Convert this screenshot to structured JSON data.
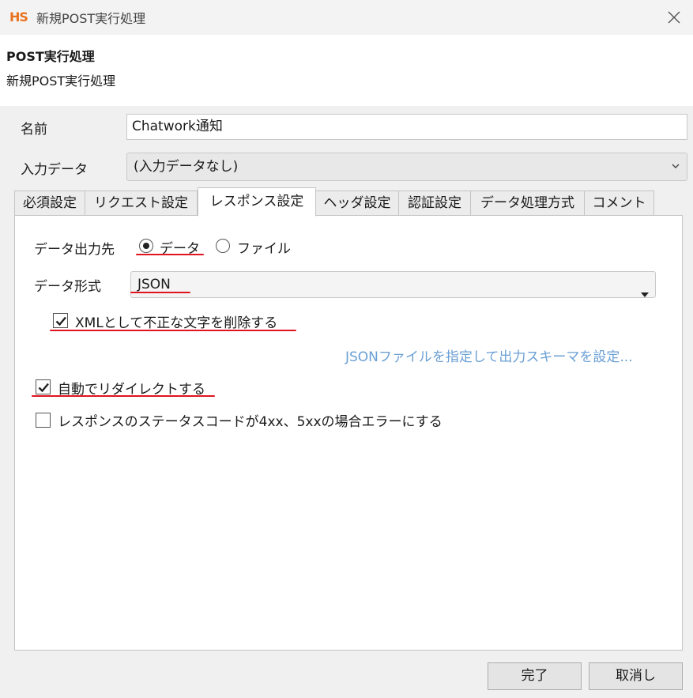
{
  "window": {
    "logo": "HS",
    "title": "新規POST実行処理"
  },
  "header": {
    "title": "POST実行処理",
    "subtitle": "新規POST実行処理"
  },
  "form": {
    "name_label": "名前",
    "name_value": "Chatwork通知",
    "input_data_label": "入力データ",
    "input_data_value": "(入力データなし)"
  },
  "tabs": [
    {
      "label": "必須設定"
    },
    {
      "label": "リクエスト設定"
    },
    {
      "label": "レスポンス設定"
    },
    {
      "label": "ヘッダ設定"
    },
    {
      "label": "認証設定"
    },
    {
      "label": "データ処理方式"
    },
    {
      "label": "コメント"
    }
  ],
  "active_tab": "レスポンス設定",
  "response": {
    "output_label": "データ出力先",
    "option_data": "データ",
    "option_file": "ファイル",
    "format_label": "データ形式",
    "format_value": "JSON",
    "xml_remove_label": "XMLとして不正な文字を削除する",
    "schema_link": "JSONファイルを指定して出力スキーマを設定...",
    "auto_redirect_label": "自動でリダイレクトする",
    "error_status_label": "レスポンスのステータスコードが4xx、5xxの場合エラーにする"
  },
  "buttons": {
    "ok": "完了",
    "cancel": "取消し"
  },
  "colors": {
    "annotation": "#e0141e",
    "link": "#6a9fd4",
    "logo": "#e8731e"
  }
}
